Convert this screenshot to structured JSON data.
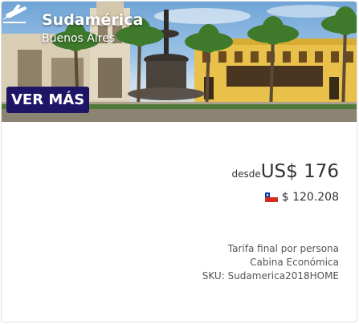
{
  "banner": {
    "region": "Sudamérica",
    "city": "Buenos Aires",
    "cta_label": "VER MÁS",
    "icon": "plane-icon"
  },
  "pricing": {
    "prefix": "desde",
    "usd_price": "US$ 176",
    "local_price": "$ 120.208",
    "flag_icon": "chile-flag-icon"
  },
  "details": {
    "line1": "Tarifa final por persona",
    "line2": "Cabina Económica",
    "line3": "SKU: Sudamerica2018HOME"
  },
  "colors": {
    "cta_background": "#1f1566",
    "text": "#333333"
  }
}
